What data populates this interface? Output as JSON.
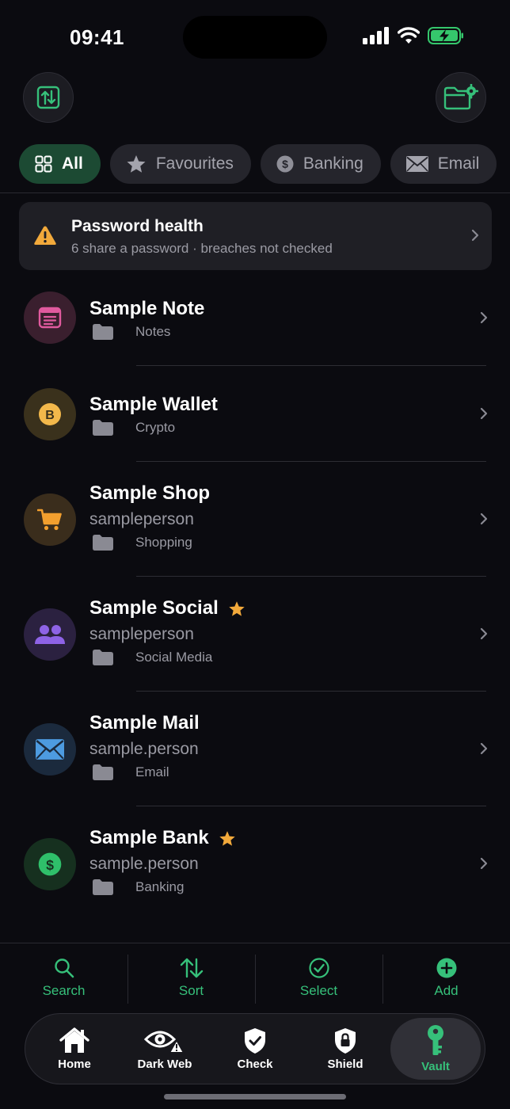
{
  "status_bar": {
    "time": "09:41"
  },
  "header": {
    "left_button_icon": "import-export-icon",
    "right_button_icon": "folder-settings-icon"
  },
  "filters": [
    {
      "label": "All",
      "icon": "grid-icon",
      "active": true
    },
    {
      "label": "Favourites",
      "icon": "star-icon",
      "active": false
    },
    {
      "label": "Banking",
      "icon": "dollar-coin-icon",
      "active": false
    },
    {
      "label": "Email",
      "icon": "envelope-icon",
      "active": false
    }
  ],
  "health": {
    "title": "Password health",
    "subtitle": "6 share a password · breaches not checked"
  },
  "items": [
    {
      "name": "Sample Note",
      "username": "",
      "folder": "Notes",
      "favourite": false,
      "icon": "note-icon",
      "accent": "#e05a9e"
    },
    {
      "name": "Sample Wallet",
      "username": "",
      "folder": "Crypto",
      "favourite": false,
      "icon": "bitcoin-icon",
      "accent": "#f2b84b"
    },
    {
      "name": "Sample Shop",
      "username": "sampleperson",
      "folder": "Shopping",
      "favourite": false,
      "icon": "cart-icon",
      "accent": "#f29f2e"
    },
    {
      "name": "Sample Social",
      "username": "sampleperson",
      "folder": "Social Media",
      "favourite": true,
      "icon": "people-icon",
      "accent": "#8e63e6"
    },
    {
      "name": "Sample Mail",
      "username": "sample.person",
      "folder": "Email",
      "favourite": false,
      "icon": "envelope-icon",
      "accent": "#4d9be0"
    },
    {
      "name": "Sample Bank",
      "username": "sample.person",
      "folder": "Banking",
      "favourite": true,
      "icon": "dollar-coin-icon",
      "accent": "#2fbf6a"
    }
  ],
  "actions": [
    {
      "label": "Search",
      "icon": "search-icon"
    },
    {
      "label": "Sort",
      "icon": "sort-icon"
    },
    {
      "label": "Select",
      "icon": "check-circle-icon"
    },
    {
      "label": "Add",
      "icon": "plus-circle-icon"
    }
  ],
  "tabs": [
    {
      "label": "Home",
      "icon": "house-icon",
      "active": false
    },
    {
      "label": "Dark Web",
      "icon": "eye-alert-icon",
      "active": false
    },
    {
      "label": "Check",
      "icon": "shield-check-icon",
      "active": false
    },
    {
      "label": "Shield",
      "icon": "shield-lock-icon",
      "active": false
    },
    {
      "label": "Vault",
      "icon": "key-icon",
      "active": true
    }
  ],
  "colors": {
    "accent": "#36c07a",
    "background": "#0b0b10",
    "star": "#f2a93b",
    "warning": "#f2a93b"
  }
}
